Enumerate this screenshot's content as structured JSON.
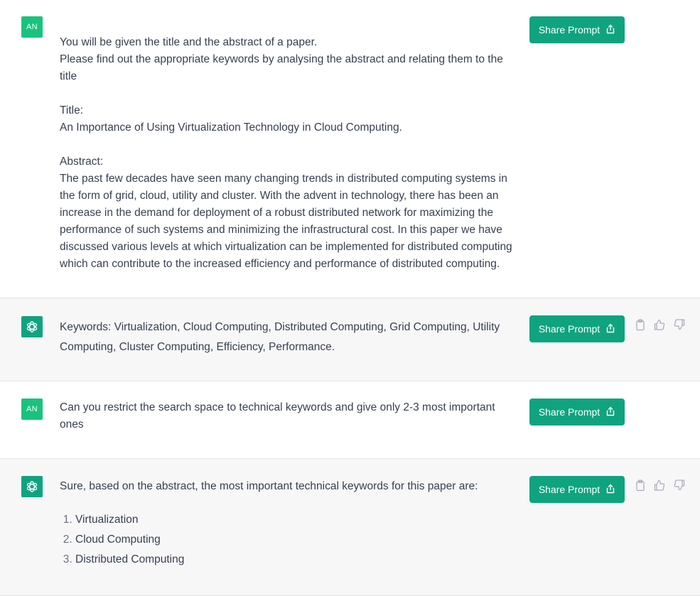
{
  "share_label": "Share Prompt",
  "avatar_user_initials": "AN",
  "colors": {
    "brand": "#10a37f",
    "user_avatar": "#19c37d",
    "bot_bg": "#f7f7f8"
  },
  "messages": [
    {
      "role": "user",
      "lines": [
        "You will be given the title and the abstract of a paper.",
        "Please find out the appropriate keywords by analysing the abstract and relating them to the title",
        "",
        "Title:",
        "An Importance of Using Virtualization Technology in Cloud Computing.",
        "",
        "Abstract:",
        "The past few decades have seen many changing trends in distributed computing systems in the form of grid, cloud, utility and cluster. With the advent in technology, there has been an increase in the demand for deployment of a robust distributed network for maximizing the performance of such systems and minimizing the infrastructural cost. In this paper we have discussed various levels at which virtualization can be implemented for distributed computing which can contribute to the increased efficiency and performance of distributed computing."
      ]
    },
    {
      "role": "assistant",
      "text": "Keywords: Virtualization, Cloud Computing, Distributed Computing, Grid Computing, Utility Computing, Cluster Computing, Efficiency, Performance."
    },
    {
      "role": "user",
      "text": "Can you restrict the search space to technical keywords and give only 2-3 most important ones"
    },
    {
      "role": "assistant",
      "intro": "Sure, based on the abstract, the most important technical keywords for this paper are:",
      "list": [
        "Virtualization",
        "Cloud Computing",
        "Distributed Computing"
      ]
    }
  ],
  "icons": [
    "openai-logo-icon",
    "share-icon",
    "clipboard-icon",
    "thumbs-up-icon",
    "thumbs-down-icon"
  ]
}
